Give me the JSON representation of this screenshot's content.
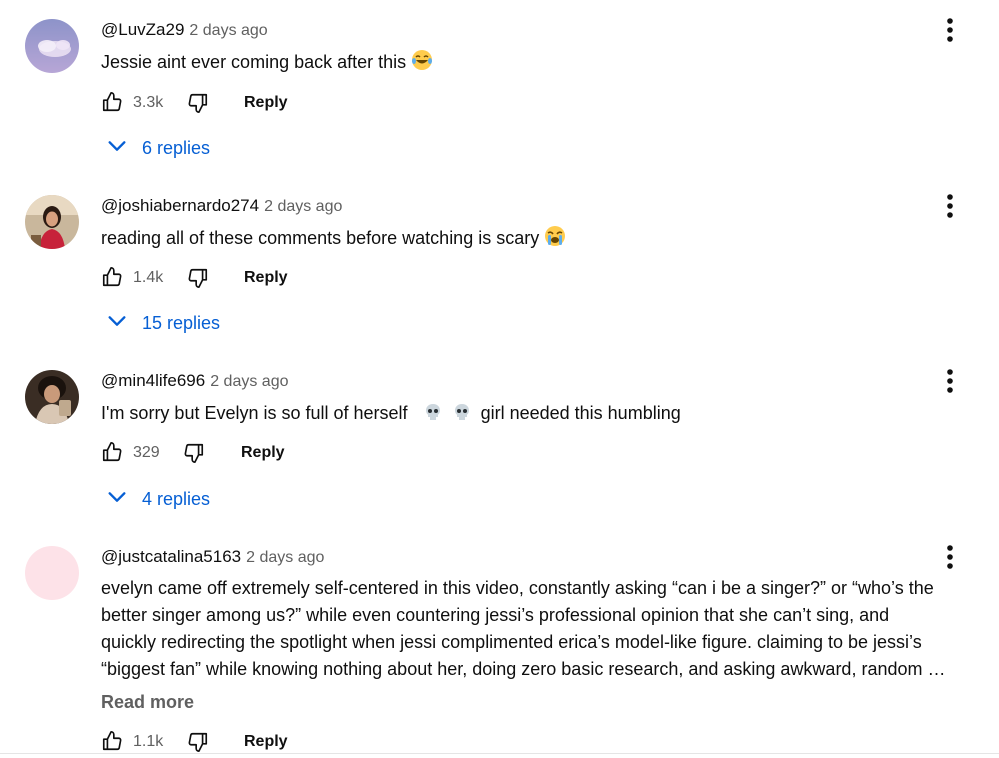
{
  "comments": [
    {
      "author": "@LuvZa29",
      "time": "2 days ago",
      "text": "Jessie aint ever coming back after this",
      "emoji": "laughing-tears-emoji",
      "likes": "3.3k",
      "reply_label": "Reply",
      "replies_label": "6 replies"
    },
    {
      "author": "@joshiabernardo274",
      "time": "2 days ago",
      "text": "reading all of these comments before watching is scary",
      "emoji": "loudly-crying-emoji",
      "likes": "1.4k",
      "reply_label": "Reply",
      "replies_label": "15 replies"
    },
    {
      "author": "@min4life696",
      "time": "2 days ago",
      "text_before": "I'm sorry but Evelyn is so full of herself",
      "text_after": "girl needed this humbling",
      "emoji": "skull-emoji",
      "likes": "329",
      "reply_label": "Reply",
      "replies_label": "4 replies"
    },
    {
      "author": "@justcatalina5163",
      "time": "2 days ago",
      "lines": [
        "evelyn came off extremely self-centered in this video, constantly asking “can i be a singer?” or “who’s the",
        "better singer among us?” while even countering jessi’s professional opinion that she can’t sing, and",
        "quickly redirecting the spotlight when jessi complimented erica’s model-like figure. claiming to be jessi’s",
        "“biggest fan” while knowing nothing about her, doing zero basic research, and asking awkward, random …"
      ],
      "read_more": "Read more",
      "likes": "1.1k",
      "reply_label": "Reply"
    }
  ],
  "colors": {
    "link_blue": "#065fd4",
    "secondary_text": "#606060",
    "primary_text": "#0f0f0f",
    "avatar_pink": "#fde2e8"
  },
  "icons": [
    "thumbs-up-icon",
    "thumbs-down-icon",
    "chevron-down-icon",
    "more-vert-icon"
  ]
}
